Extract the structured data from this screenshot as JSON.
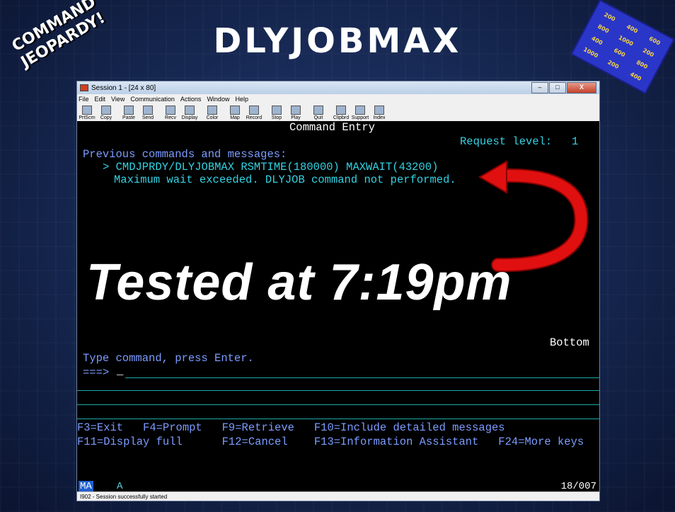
{
  "slide": {
    "title": "DLYJOBMAX",
    "badge_left": "COMMAND JEOPARDY!",
    "badge_right_values": [
      "200",
      "400",
      "600",
      "800",
      "1000",
      "200",
      "400",
      "600",
      "800",
      "1000",
      "200",
      "400"
    ],
    "overlay_text": "Tested at 7:19pm",
    "arrow_color": "#e01010"
  },
  "window": {
    "title": "Session 1 - [24 x 80]",
    "menu": [
      "File",
      "Edit",
      "View",
      "Communication",
      "Actions",
      "Window",
      "Help"
    ],
    "toolbar": [
      "PrtScrn",
      "Copy",
      "Paste",
      "Send",
      "Recv",
      "Display",
      "Color",
      "Map",
      "Record",
      "Stop",
      "Play",
      "Quit",
      "Clipbrd",
      "Support",
      "Index"
    ],
    "controls": {
      "minimize": "–",
      "maximize": "□",
      "close": "X"
    }
  },
  "terminal": {
    "screen_title": "Command Entry",
    "request_level_label": "Request level:",
    "request_level_value": "1",
    "previous_header": "Previous commands and messages:",
    "command_line": "> CMDJPRDY/DLYJOBMAX RSMTIME(180000) MAXWAIT(43200)",
    "message_line": "Maximum wait exceeded. DLYJOB command not performed.",
    "bottom_label": "Bottom",
    "prompt_text": "Type command, press Enter.",
    "input_prompt": "===>",
    "cursor": "_",
    "fkeys_row1": "F3=Exit   F4=Prompt   F9=Retrieve   F10=Include detailed messages",
    "fkeys_row2": "F11=Display full      F12=Cancel    F13=Information Assistant   F24=More keys",
    "oia_ma": "MA",
    "oia_a": "A",
    "oia_position": "18/007"
  },
  "status_bar": "I902 - Session successfully started"
}
